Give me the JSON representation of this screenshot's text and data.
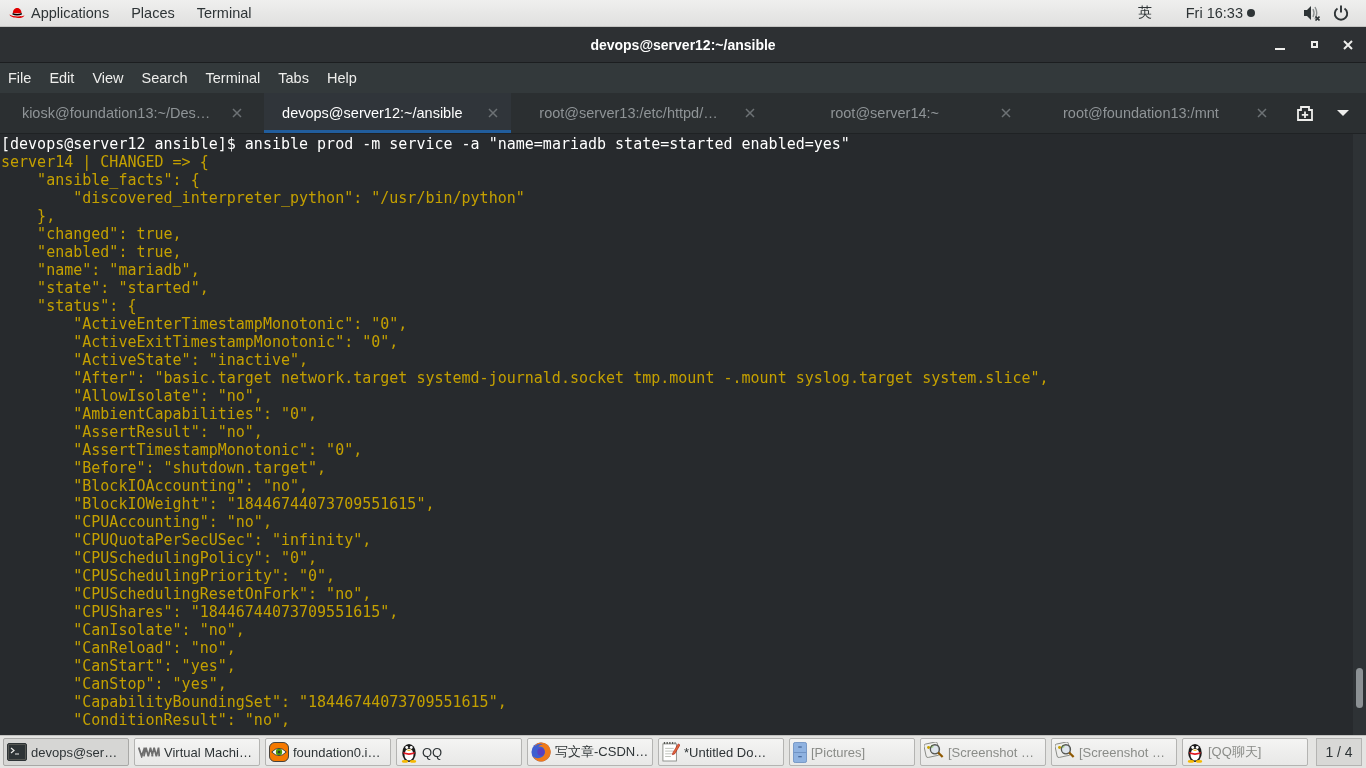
{
  "top_bar": {
    "menus": [
      "Applications",
      "Places",
      "Terminal"
    ],
    "input_method": "英",
    "clock": "Fri 16:33"
  },
  "window": {
    "title": "devops@server12:~/ansible"
  },
  "menu_bar": [
    "File",
    "Edit",
    "View",
    "Search",
    "Terminal",
    "Tabs",
    "Help"
  ],
  "tabs": [
    {
      "label": "kiosk@foundation13:~/Des…",
      "selected": false
    },
    {
      "label": "devops@server12:~/ansible",
      "selected": true
    },
    {
      "label": "root@server13:/etc/httpd/…",
      "selected": false
    },
    {
      "label": "root@server14:~",
      "selected": false
    },
    {
      "label": "root@foundation13:/mnt",
      "selected": false
    }
  ],
  "terminal": {
    "lines": [
      {
        "kind": "prompt",
        "text": "[devops@server12 ansible]$ ansible prod -m service -a \"name=mariadb state=started enabled=yes\""
      },
      {
        "kind": "output",
        "text": "server14 | CHANGED => {",
        "children": [
          {
            "text": "\"ansible_facts\": {",
            "children": [
              {
                "text": "\"discovered_interpreter_python\": \"/usr/bin/python\""
              }
            ]
          },
          {
            "text": "},"
          },
          {
            "text": "\"changed\": true,"
          },
          {
            "text": "\"enabled\": true,"
          },
          {
            "text": "\"name\": \"mariadb\","
          },
          {
            "text": "\"state\": \"started\","
          },
          {
            "text": "\"status\": {",
            "children": [
              {
                "text": "\"ActiveEnterTimestampMonotonic\": \"0\","
              },
              {
                "text": "\"ActiveExitTimestampMonotonic\": \"0\","
              },
              {
                "text": "\"ActiveState\": \"inactive\","
              },
              {
                "text": "\"After\": \"basic.target network.target systemd-journald.socket tmp.mount -.mount syslog.target system.slice\","
              },
              {
                "text": "\"AllowIsolate\": \"no\","
              },
              {
                "text": "\"AmbientCapabilities\": \"0\","
              },
              {
                "text": "\"AssertResult\": \"no\","
              },
              {
                "text": "\"AssertTimestampMonotonic\": \"0\","
              },
              {
                "text": "\"Before\": \"shutdown.target\","
              },
              {
                "text": "\"BlockIOAccounting\": \"no\","
              },
              {
                "text": "\"BlockIOWeight\": \"18446744073709551615\","
              },
              {
                "text": "\"CPUAccounting\": \"no\","
              },
              {
                "text": "\"CPUQuotaPerSecUSec\": \"infinity\","
              },
              {
                "text": "\"CPUSchedulingPolicy\": \"0\","
              },
              {
                "text": "\"CPUSchedulingPriority\": \"0\","
              },
              {
                "text": "\"CPUSchedulingResetOnFork\": \"no\","
              },
              {
                "text": "\"CPUShares\": \"18446744073709551615\","
              },
              {
                "text": "\"CanIsolate\": \"no\","
              },
              {
                "text": "\"CanReload\": \"no\","
              },
              {
                "text": "\"CanStart\": \"yes\","
              },
              {
                "text": "\"CanStop\": \"yes\","
              },
              {
                "text": "\"CapabilityBoundingSet\": \"18446744073709551615\","
              },
              {
                "text": "\"ConditionResult\": \"no\","
              }
            ]
          }
        ]
      }
    ]
  },
  "taskbar": {
    "items": [
      {
        "label": "devops@ser…",
        "kind": "terminal",
        "selected": true,
        "minimized": false
      },
      {
        "label": "Virtual Machi…",
        "kind": "vm",
        "selected": false,
        "minimized": false
      },
      {
        "label": "foundation0.i…",
        "kind": "viewer",
        "selected": false,
        "minimized": false
      },
      {
        "label": "QQ",
        "kind": "chat",
        "selected": false,
        "minimized": false
      },
      {
        "label": "写文章-CSDN…",
        "kind": "browser",
        "selected": false,
        "minimized": false
      },
      {
        "label": "*Untitled Do…",
        "kind": "editor",
        "selected": false,
        "minimized": false
      },
      {
        "label": "[Pictures]",
        "kind": "files",
        "selected": false,
        "minimized": true
      },
      {
        "label": "[Screenshot …",
        "kind": "screenshot",
        "selected": false,
        "minimized": true
      },
      {
        "label": "[Screenshot …",
        "kind": "screenshot",
        "selected": false,
        "minimized": true
      },
      {
        "label": "[QQ聊天]",
        "kind": "chat",
        "selected": false,
        "minimized": true
      }
    ],
    "workspace": "1 / 4"
  }
}
